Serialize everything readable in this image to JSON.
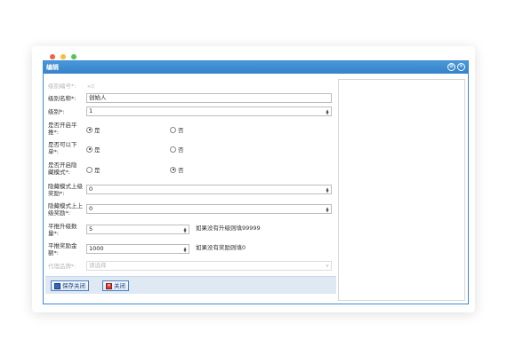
{
  "dialog": {
    "title": "编辑",
    "min_icon_glyph": "⊘",
    "close_icon_glyph": "✕"
  },
  "form": {
    "level_code": {
      "label": "级别编号*:",
      "value": "xd"
    },
    "level_name": {
      "label": "级别名称*:",
      "value": "创始人"
    },
    "level": {
      "label": "级别*:",
      "value": "1"
    },
    "open_peer": {
      "label": "是否开启平推*:",
      "options": [
        "是",
        "否"
      ],
      "selected": "是"
    },
    "can_order": {
      "label": "是否可以下单*:",
      "options": [
        "是",
        "否"
      ],
      "selected": "是"
    },
    "hidden_mode": {
      "label": "是否开启隐藏模式*:",
      "options": [
        "是",
        "否"
      ],
      "selected": "否"
    },
    "hidden_upper_reward": {
      "label": "隐藏模式上级奖励*:",
      "value": "0"
    },
    "hidden_upper2_reward": {
      "label": "隐藏模式上上级奖励*:",
      "value": "0"
    },
    "peer_upgrade_count": {
      "label": "平推升级数量*:",
      "value": "5",
      "hint": "如果没有升级则填99999"
    },
    "peer_reward_amount": {
      "label": "平推奖励金额*:",
      "value": "1000",
      "hint": "如果没有奖励则填0"
    },
    "agent_brand": {
      "label": "代理品牌*:",
      "placeholder": "请选择"
    }
  },
  "footer": {
    "save_label": "保存关闭",
    "close_label": "关闭"
  }
}
